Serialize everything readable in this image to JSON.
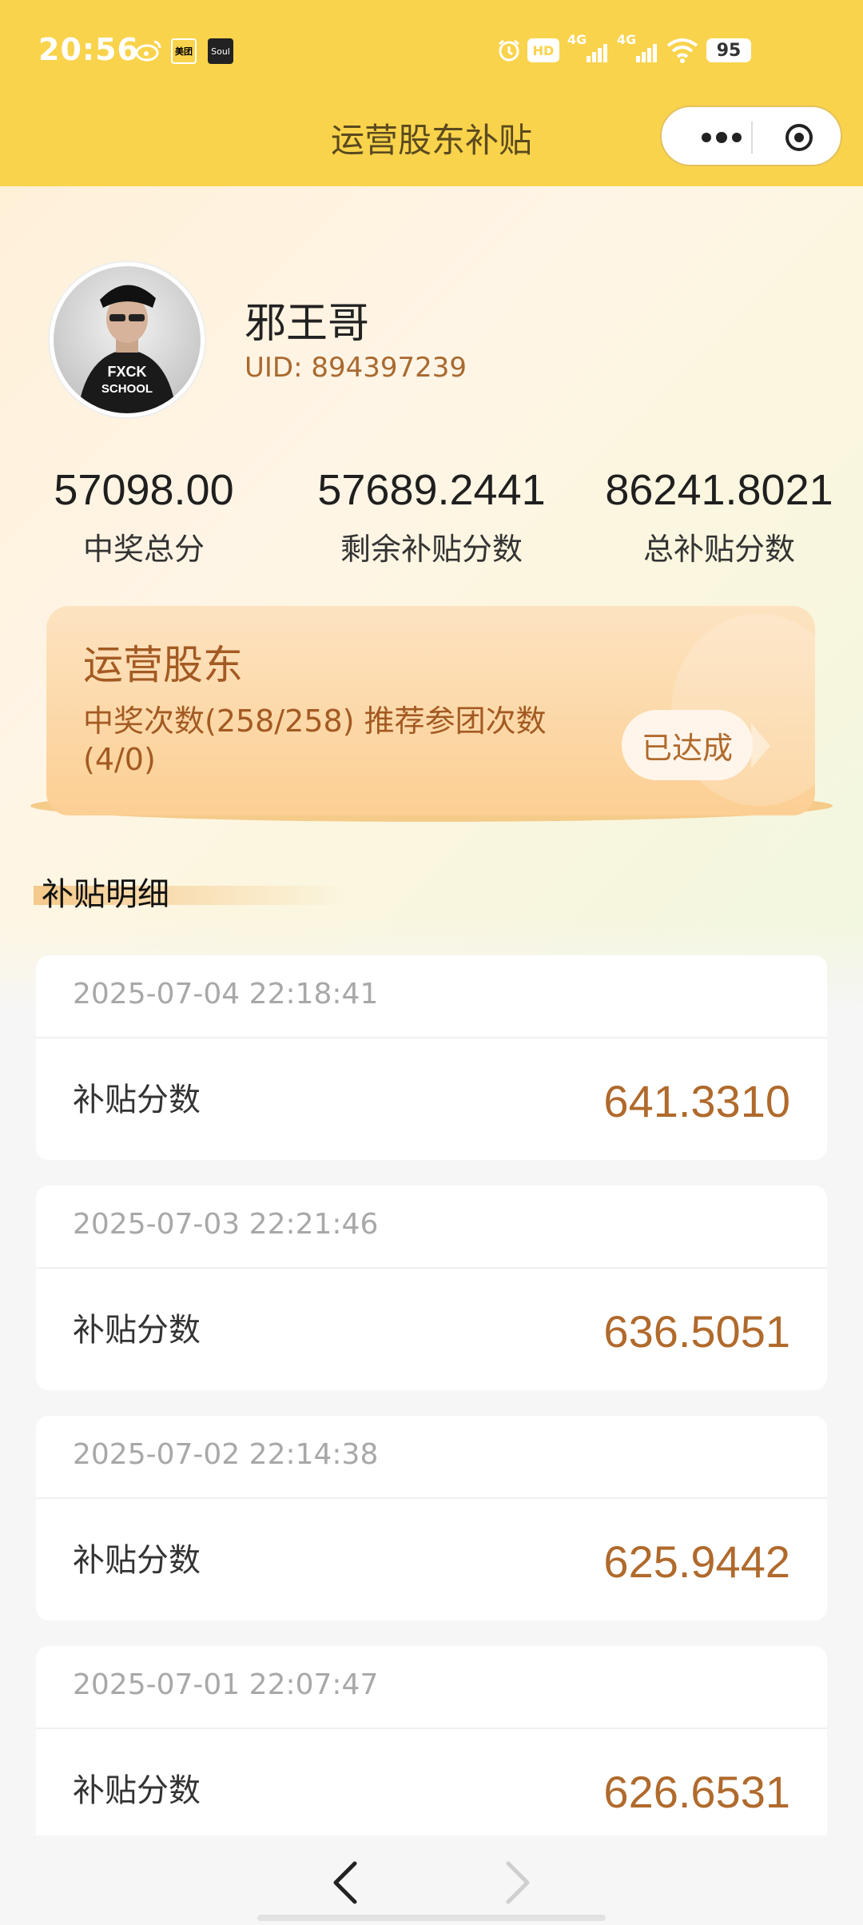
{
  "status_bar": {
    "time": "20:56",
    "battery": "95",
    "network_1": "4G",
    "network_2": "4G",
    "hd_label": "HD",
    "meituan_label": "美团",
    "soul_label": "Soul"
  },
  "nav": {
    "title": "运营股东补贴"
  },
  "profile": {
    "name": "邪王哥",
    "uid": "UID: 894397239",
    "shirt_text_1": "FXCK",
    "shirt_text_2": "SCHOOL"
  },
  "stats": [
    {
      "value": "57098.00",
      "label": "中奖总分"
    },
    {
      "value": "57689.2441",
      "label": "剩余补贴分数"
    },
    {
      "value": "86241.8021",
      "label": "总补贴分数"
    }
  ],
  "rank_card": {
    "title": "运营股东",
    "description": "中奖次数(258/258) 推荐参团次数(4/0)",
    "status": "已达成"
  },
  "section": {
    "title": "补贴明细"
  },
  "records": [
    {
      "date": "2025-07-04 22:18:41",
      "label": "补贴分数",
      "value": "641.3310"
    },
    {
      "date": "2025-07-03 22:21:46",
      "label": "补贴分数",
      "value": "636.5051"
    },
    {
      "date": "2025-07-02 22:14:38",
      "label": "补贴分数",
      "value": "625.9442"
    },
    {
      "date": "2025-07-01 22:07:47",
      "label": "补贴分数",
      "value": "626.6531"
    }
  ],
  "colors": {
    "header_yellow": "#f9d34c",
    "accent_brown": "#b06a2c"
  }
}
